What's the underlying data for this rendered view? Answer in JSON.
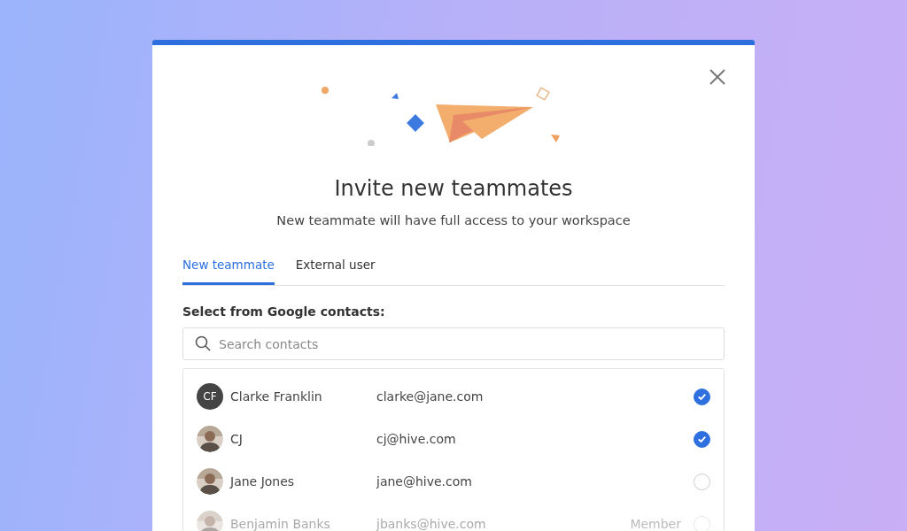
{
  "dialog": {
    "title": "Invite new teammates",
    "subtitle": "New teammate will have full access to your workspace"
  },
  "tabs": [
    {
      "label": "New teammate",
      "selected": true
    },
    {
      "label": "External user",
      "selected": false
    }
  ],
  "contacts_label": "Select from Google contacts:",
  "search": {
    "placeholder": "Search contacts"
  },
  "contacts": [
    {
      "avatar": {
        "kind": "initials",
        "text": "CF"
      },
      "name": "Clarke Franklin",
      "email": "clarke@jane.com",
      "checked": true,
      "disabled": false
    },
    {
      "name": "CJ",
      "email": "cj@hive.com",
      "checked": true,
      "disabled": false
    },
    {
      "name": "Jane Jones",
      "email": "jane@hive.com",
      "checked": false,
      "disabled": false
    },
    {
      "name": "Benjamin Banks",
      "email": "jbanks@hive.com",
      "checked": false,
      "disabled": true,
      "role": "Member"
    }
  ]
}
